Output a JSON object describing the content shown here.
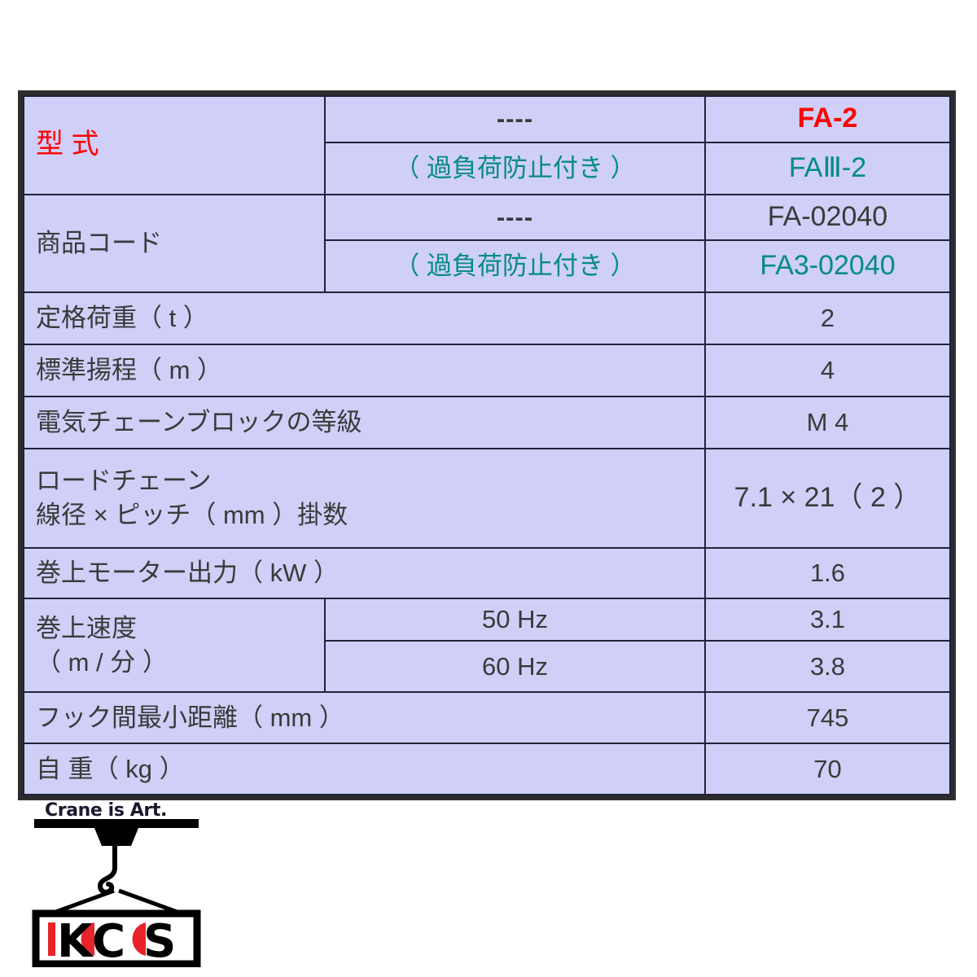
{
  "table": {
    "colors": {
      "label_bg": "#cfcff7",
      "value_bg": "#fbfbcc",
      "border": "#22223a",
      "frame": "#2b2b2b",
      "accent_red": "#ff0000",
      "accent_teal": "#048a8a",
      "text": "#3a3a3a"
    },
    "rows": [
      {
        "id": "model",
        "label": "型 式",
        "label_color": "red",
        "sub": "----",
        "sub_kind": "dashes",
        "value": "FA-2",
        "value_color": "red",
        "value_bold": true
      },
      {
        "id": "model-overload",
        "sub": "（ 過負荷防止付き ）",
        "sub_color": "teal",
        "value": "FAⅢ-2",
        "value_color": "teal"
      },
      {
        "id": "product-code",
        "label": "商品コード",
        "label_color": "dark",
        "sub": "----",
        "sub_kind": "dashes",
        "value": "FA-02040",
        "value_color": "dark"
      },
      {
        "id": "product-code-overload",
        "sub": "（ 過負荷防止付き ）",
        "sub_color": "teal",
        "value": "FA3-02040",
        "value_color": "teal"
      },
      {
        "id": "rated-load",
        "label": "定格荷重（ t ）",
        "value": "2"
      },
      {
        "id": "standard-lift",
        "label": "標準揚程（ m ）",
        "value": "4"
      },
      {
        "id": "hoist-class",
        "label": "電気チェーンブロックの等級",
        "value": "M 4"
      },
      {
        "id": "load-chain",
        "label_line1": "ロードチェーン",
        "label_line2": "線径 × ピッチ（ mm ）掛数",
        "value": "7.1 × 21（ 2 ）"
      },
      {
        "id": "motor-output",
        "label": "巻上モーター出力（ kW ）",
        "value": "1.6"
      },
      {
        "id": "hoist-speed-50",
        "label_line1": "巻上速度",
        "label_line2": "（ m / 分 ）",
        "sub": "50 Hz",
        "value": "3.1"
      },
      {
        "id": "hoist-speed-60",
        "sub": "60 Hz",
        "value": "3.8"
      },
      {
        "id": "min-hook-distance",
        "label": "フック間最小距離（ mm ）",
        "value": "745"
      },
      {
        "id": "self-weight",
        "label": "自 重（ kg ）",
        "value": "70"
      }
    ]
  },
  "logo": {
    "tagline": "Crane is Art.",
    "brand": "KCS",
    "brand_letters": [
      "K",
      "C",
      "S"
    ],
    "accent_color": "#e8232a",
    "ink_color": "#000000"
  }
}
